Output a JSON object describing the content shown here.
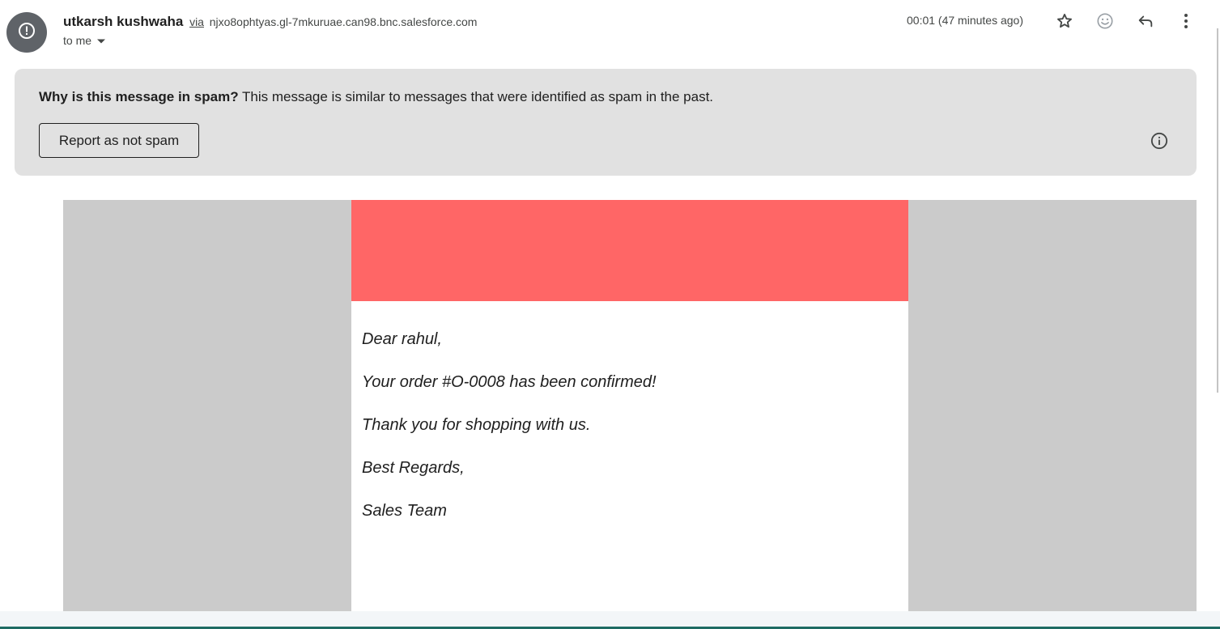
{
  "header": {
    "sender_name": "utkarsh kushwaha",
    "via_label": "via",
    "sender_domain": "njxo8ophtyas.gl-7mkuruae.can98.bnc.salesforce.com",
    "recipient_label": "to me",
    "timestamp": "00:01 (47 minutes ago)",
    "icons": [
      "warning-icon",
      "chevron-down-icon",
      "star-icon",
      "emoji-icon",
      "reply-icon",
      "more-vert-icon"
    ]
  },
  "spam_banner": {
    "question": "Why is this message in spam?",
    "explanation": "This message is similar to messages that were identified as spam in the past.",
    "report_button": "Report as not spam",
    "info_icon": "info-icon"
  },
  "email": {
    "banner_color": "#ff6666",
    "paragraphs": [
      "Dear rahul,",
      "Your order #O-0008 has been confirmed!",
      "Thank you for shopping with us.",
      "Best Regards,",
      "Sales Team"
    ]
  },
  "colors": {
    "spam_banner_bg": "#e1e1e1",
    "email_outer_bg": "#cbcbcb",
    "avatar_bg": "#5f6368"
  }
}
